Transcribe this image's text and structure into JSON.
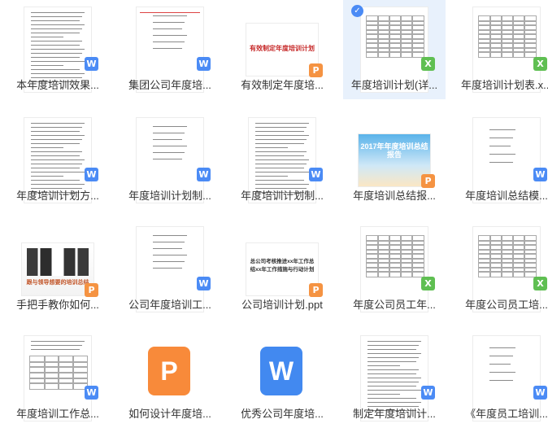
{
  "files": [
    {
      "name": "本年度培训效果...",
      "type": "W"
    },
    {
      "name": "集团公司年度培...",
      "type": "W"
    },
    {
      "name": "有效制定年度培...",
      "type": "P",
      "thumb_title": "有效制定年度培训计划"
    },
    {
      "name": "年度培训计划(详...",
      "type": "X",
      "selected": true
    },
    {
      "name": "年度培训计划表.x...",
      "type": "X"
    },
    {
      "name": "年度培训计划方...",
      "type": "W"
    },
    {
      "name": "年度培训计划制...",
      "type": "W"
    },
    {
      "name": "年度培训计划制...",
      "type": "W"
    },
    {
      "name": "年度培训总结报...",
      "type": "P",
      "thumb_title": "2017年年度培训总结报告"
    },
    {
      "name": "年度培训总结模...",
      "type": "W"
    },
    {
      "name": "手把手教你如何...",
      "type": "P",
      "thumb_title": "跟与领导想要的培训总结"
    },
    {
      "name": "公司年度培训工...",
      "type": "W"
    },
    {
      "name": "公司培训计划.ppt",
      "type": "P",
      "thumb_title": "总公司考核推进xx年工作总结xx年工作措施与行动计划"
    },
    {
      "name": "年度公司员工年...",
      "type": "X"
    },
    {
      "name": "年度公司员工培...",
      "type": "X"
    },
    {
      "name": "年度培训工作总...",
      "type": "W"
    },
    {
      "name": "如何设计年度培...",
      "type": "P"
    },
    {
      "name": "优秀公司年度培...",
      "type": "W"
    },
    {
      "name": "制定年度培训计...",
      "type": "W"
    },
    {
      "name": "《年度员工培训...",
      "type": "W"
    }
  ],
  "icons": {
    "W": "wps-writer-icon",
    "P": "wps-presentation-icon",
    "X": "wps-spreadsheet-icon"
  },
  "colors": {
    "W": "#4b8bf5",
    "P": "#f59342",
    "X": "#5fbf52",
    "selected": "#e8f1fc"
  }
}
